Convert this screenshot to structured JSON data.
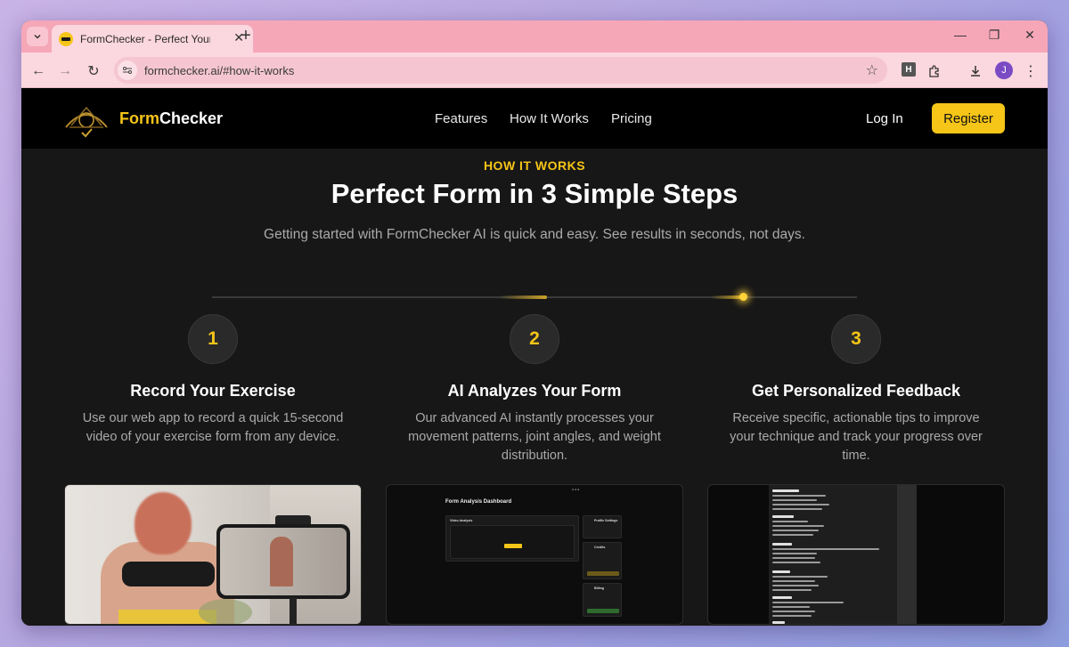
{
  "browser": {
    "tab_title": "FormChecker - Perfect Your Form",
    "url": "formchecker.ai/#how-it-works",
    "profile_initial": "J",
    "extension_label": "H"
  },
  "nav": {
    "brand_prefix": "Form",
    "brand_suffix": "Checker",
    "links": [
      "Features",
      "How It Works",
      "Pricing"
    ],
    "login": "Log In",
    "register": "Register"
  },
  "hero": {
    "eyebrow": "HOW IT WORKS",
    "title": "Perfect Form in 3 Simple Steps",
    "subtitle": "Getting started with FormChecker AI is quick and easy. See results in seconds, not days."
  },
  "steps": [
    {
      "number": "1",
      "title": "Record Your Exercise",
      "text": "Use our web app to record a quick 15-second video of your exercise form from any device."
    },
    {
      "number": "2",
      "title": "AI Analyzes Your Form",
      "text": "Our advanced AI instantly processes your movement patterns, joint angles, and weight distribution."
    },
    {
      "number": "3",
      "title": "Get Personalized Feedback",
      "text": "Receive specific, actionable tips to improve your technique and track your progress over time."
    }
  ],
  "dashboard": {
    "title": "Form Analysis Dashboard",
    "video_label": "Video Analysis",
    "profile_label": "Profile Settings",
    "credits_label": "Credits",
    "billing_label": "Billing",
    "upload_label": "Upload Video"
  },
  "colors": {
    "accent": "#f5c518",
    "page_bg": "#171717",
    "nav_bg": "#000000"
  }
}
